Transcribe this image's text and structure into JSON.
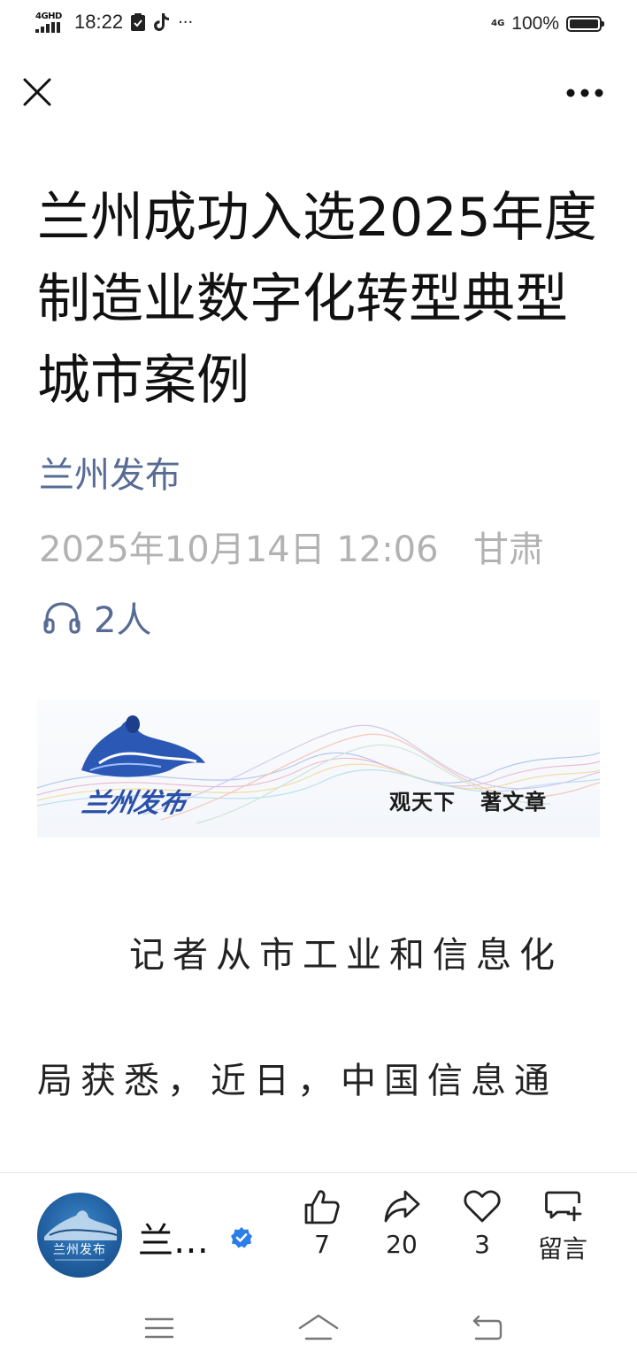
{
  "status_bar": {
    "network": "4GHD",
    "time": "18:22",
    "network_right": "4G",
    "battery": "100%"
  },
  "article": {
    "title": "兰州成功入选2025年度制造业数字化转型典型城市案例",
    "author": "兰州发布",
    "date": "2025年10月14日 12:06",
    "location": "甘肃",
    "listeners": "2人",
    "banner": {
      "logo_text": "兰州发布",
      "slogan": "观天下   著文章"
    },
    "paragraphs": [
      "记者从市工业和信息化",
      "局获悉，近日，中国信息通"
    ]
  },
  "bottom_bar": {
    "account_name": "兰…",
    "avatar_text": "兰州发布",
    "actions": {
      "like": "7",
      "share": "20",
      "favorite": "3",
      "comment": "留言"
    }
  }
}
